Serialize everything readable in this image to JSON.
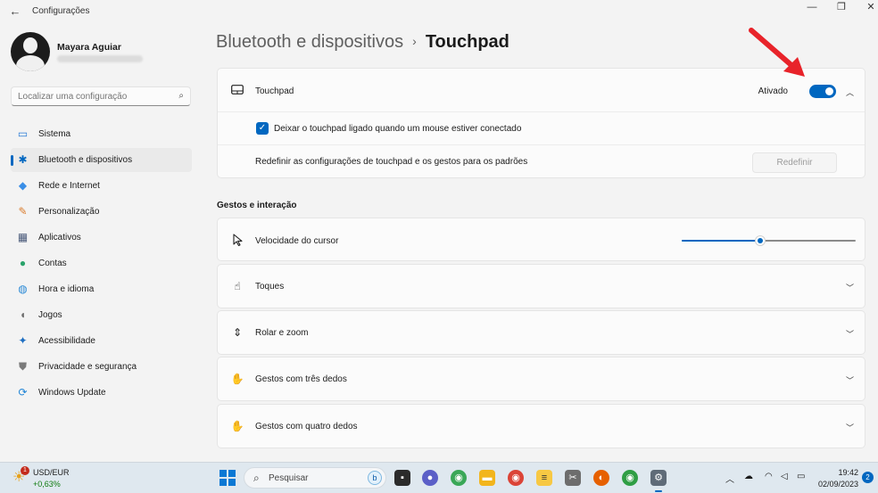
{
  "window": {
    "app_title": "Configurações",
    "back_glyph": "←",
    "minimize_glyph": "—",
    "maximize_glyph": "❐",
    "close_glyph": "✕"
  },
  "profile": {
    "name": "Mayara Aguiar"
  },
  "search": {
    "placeholder": "Localizar uma configuração",
    "icon": "search-icon"
  },
  "nav": [
    {
      "label": "Sistema",
      "icon": "monitor-icon",
      "glyph": "▭",
      "color": "#2b7bd6",
      "active": false
    },
    {
      "label": "Bluetooth e dispositivos",
      "icon": "bluetooth-icon",
      "glyph": "✱",
      "color": "#0067c0",
      "active": true
    },
    {
      "label": "Rede e Internet",
      "icon": "wifi-icon",
      "glyph": "◆",
      "color": "#3a8ee6",
      "active": false
    },
    {
      "label": "Personalização",
      "icon": "brush-icon",
      "glyph": "✎",
      "color": "#d97b2b",
      "active": false
    },
    {
      "label": "Aplicativos",
      "icon": "apps-icon",
      "glyph": "▦",
      "color": "#4a5a7a",
      "active": false
    },
    {
      "label": "Contas",
      "icon": "person-icon",
      "glyph": "●",
      "color": "#2aa36b",
      "active": false
    },
    {
      "label": "Hora e idioma",
      "icon": "globe-clock-icon",
      "glyph": "◍",
      "color": "#2b8ad6",
      "active": false
    },
    {
      "label": "Jogos",
      "icon": "gamepad-icon",
      "glyph": "◖",
      "color": "#6b6b6b",
      "active": false
    },
    {
      "label": "Acessibilidade",
      "icon": "accessibility-icon",
      "glyph": "✦",
      "color": "#1f6fc2",
      "active": false
    },
    {
      "label": "Privacidade e segurança",
      "icon": "shield-icon",
      "glyph": "⛊",
      "color": "#7a7a7a",
      "active": false
    },
    {
      "label": "Windows Update",
      "icon": "update-icon",
      "glyph": "⟳",
      "color": "#1f84d6",
      "active": false
    }
  ],
  "breadcrumb": {
    "parent": "Bluetooth e dispositivos",
    "separator": "›",
    "current": "Touchpad"
  },
  "touchpad": {
    "label": "Touchpad",
    "status": "Ativado",
    "enabled": true,
    "checkbox_label": "Deixar o touchpad ligado quando um mouse estiver conectado",
    "checkbox_checked": true,
    "reset_label": "Redefinir as configurações de touchpad e os gestos para os padrões",
    "reset_button": "Redefinir"
  },
  "gestures": {
    "section_title": "Gestos e interação",
    "cursor_speed": {
      "label": "Velocidade do cursor",
      "value": 0.45
    },
    "items": [
      {
        "label": "Toques",
        "icon": "tap-icon",
        "glyph": "☝"
      },
      {
        "label": "Rolar e zoom",
        "icon": "scroll-zoom-icon",
        "glyph": "⇕"
      },
      {
        "label": "Gestos com três dedos",
        "icon": "three-finger-icon",
        "glyph": "✋"
      },
      {
        "label": "Gestos com quatro dedos",
        "icon": "four-finger-icon",
        "glyph": "✋"
      }
    ]
  },
  "taskbar": {
    "ticker": "USD/EUR",
    "change": "+0,63%",
    "weather_badge": "1",
    "search_placeholder": "Pesquisar",
    "time": "19:42",
    "date": "02/09/2023",
    "notifications": "2",
    "accent": "#0067c0"
  }
}
